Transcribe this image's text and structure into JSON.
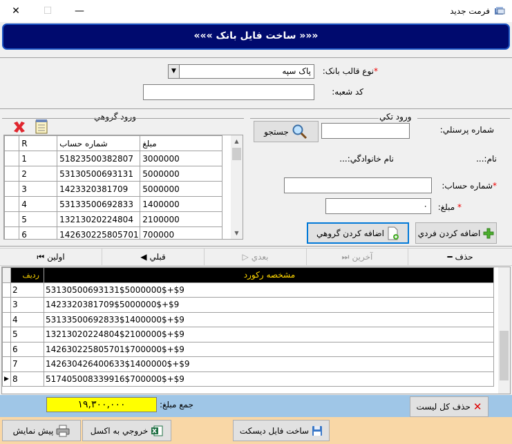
{
  "window": {
    "title": "فرمت جديد",
    "minimize": "—",
    "maximize": "☐",
    "close": "✕"
  },
  "banner": {
    "title": "«««  ساخت فايل بانک  »»»"
  },
  "form": {
    "bank_template_label": "نوع قالب بانک:",
    "bank_template_value": "پاک سپه",
    "branch_code_label": "کد شعبه:",
    "branch_code_value": ""
  },
  "group_entry": {
    "section_label": "ورود گروهي",
    "columns": [
      "R",
      "شماره حساب",
      "مبلغ"
    ],
    "rows": [
      {
        "r": "1",
        "account": "51823500382807",
        "amount": "3000000"
      },
      {
        "r": "2",
        "account": "53130500693131",
        "amount": "5000000"
      },
      {
        "r": "3",
        "account": "1423320381709",
        "amount": "5000000"
      },
      {
        "r": "4",
        "account": "53133500692833",
        "amount": "1400000"
      },
      {
        "r": "5",
        "account": "13213020224804",
        "amount": "2100000"
      },
      {
        "r": "6",
        "account": "142630225805701",
        "amount": "700000"
      }
    ]
  },
  "single_entry": {
    "section_label": "ورود تکي",
    "personnel_label": "شماره پرسنلي:",
    "search_button": "جستجو",
    "name_label": "نام:...",
    "family_label": "نام خانوادگي:...",
    "account_label": "شماره حساب:",
    "amount_label": "مبلغ:",
    "amount_value": "۰",
    "add_single_button": "اضافه کردن فردي",
    "add_group_button": "اضافه کردن گروهي"
  },
  "nav": {
    "first": "اولين",
    "previous": "قبلي",
    "next": "بعدي",
    "last": "آخرين",
    "delete": "حذف"
  },
  "records": {
    "col_row": "رديف",
    "col_spec": "مشخصه رکورد",
    "rows": [
      {
        "n": "2",
        "spec": "53130500693131$5000000$+$9"
      },
      {
        "n": "3",
        "spec": "1423320381709$5000000$+$9"
      },
      {
        "n": "4",
        "spec": "53133500692833$1400000$+$9"
      },
      {
        "n": "5",
        "spec": "13213020224804$2100000$+$9"
      },
      {
        "n": "6",
        "spec": "142630225805701$700000$+$9"
      },
      {
        "n": "7",
        "spec": "142630426400633$1400000$+$9"
      },
      {
        "n": "8",
        "spec": "517405008339916$700000$+$9"
      }
    ]
  },
  "summary": {
    "total_label": "جمع مبلغ:",
    "total_value": "۱۹,۳۰۰,۰۰۰",
    "delete_all_button": "حذف کل ليست"
  },
  "footer": {
    "build_file_button": "ساخت فايل ديسکت",
    "excel_button": "خروجي به اکسل",
    "preview_button": "پيش نمايش"
  }
}
